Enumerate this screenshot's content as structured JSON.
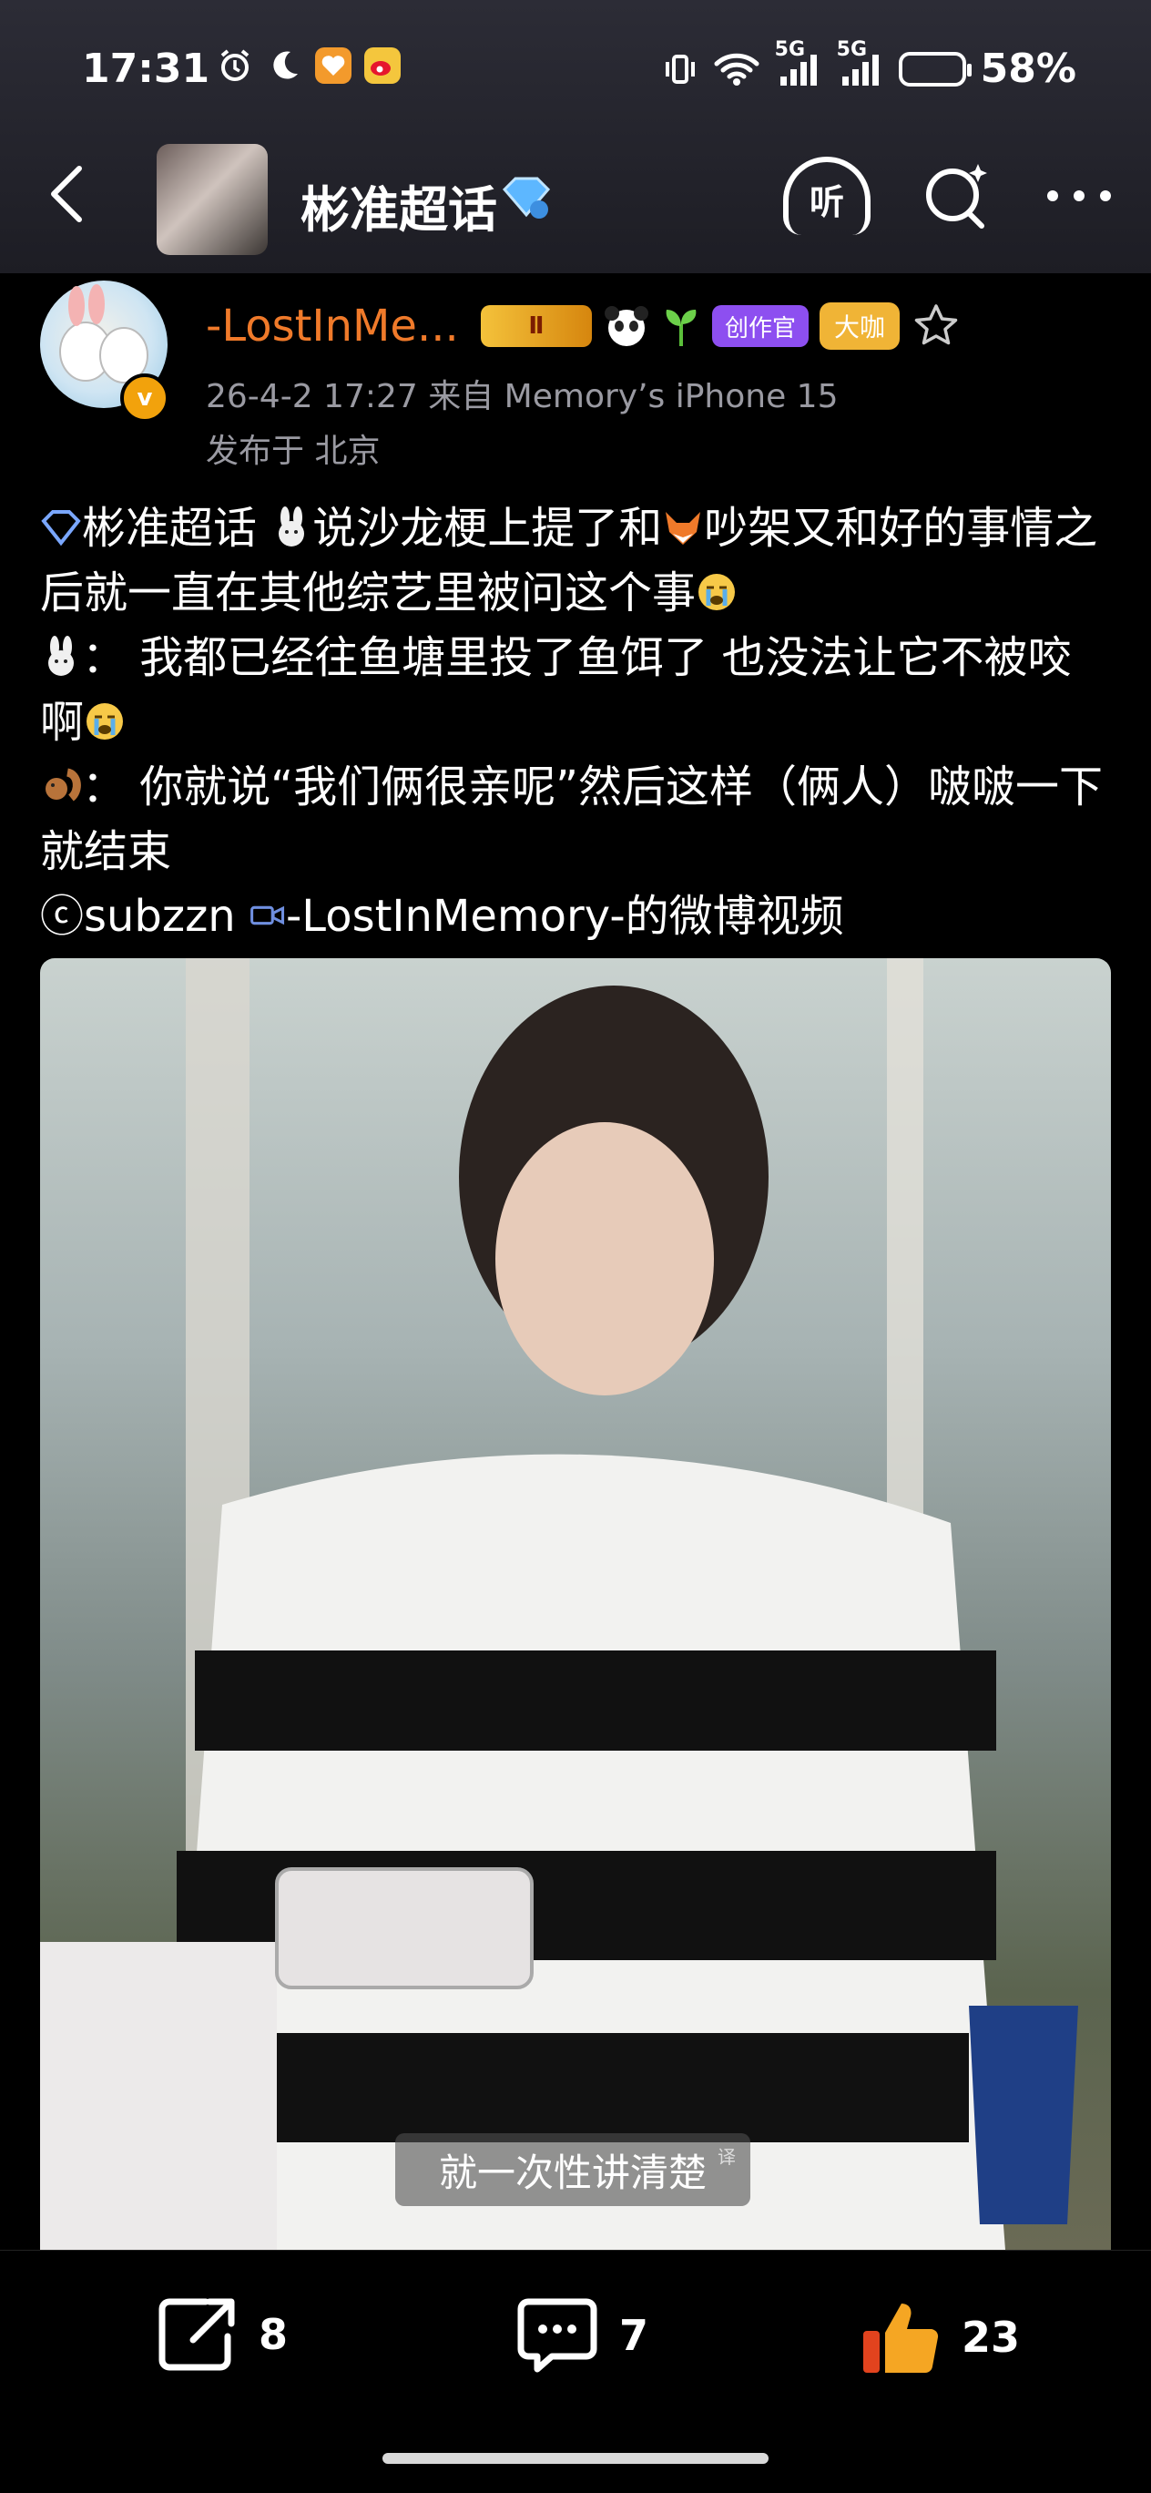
{
  "status_bar": {
    "time": "17:31",
    "signal_labels": [
      "5G",
      "5G"
    ],
    "battery": "58%",
    "left_icons": [
      "alarm-icon",
      "moon-icon",
      "heart-app-icon",
      "weibo-icon"
    ],
    "right_icons": [
      "vibrate-icon",
      "wifi-icon",
      "signal-icon",
      "signal-icon",
      "battery-icon"
    ]
  },
  "nav": {
    "title": "彬准超话",
    "listen_label": "听"
  },
  "post": {
    "author": "-LostInMe...",
    "level_badge": "Ⅱ",
    "creator_badge": "创作官",
    "big_badge": "大咖",
    "meta_time_source": "26-4-2 17:27   来自 Memory’s iPhone 15",
    "meta_location": "发布于 北京",
    "lines": {
      "l1_topic": "彬准超话",
      "l1_text1": "说沙龙梗上提了和",
      "l1_text2": "吵架又和好的事情之后就一直在其他综艺里被问这个事",
      "l2_text": "：  我都已经往鱼塘里投了鱼饵了 也没法让它不被咬啊",
      "l3_text": "：  你就说“我们俩很亲呢”然后这样（俩人）啵啵一下就结束",
      "l4_copyright": "ⓒsubzzn",
      "l4_video_link": "-LostInMemory-的微博视频"
    },
    "video_subtitle": "就一次性讲清楚",
    "video_subtitle_tag": "译"
  },
  "actions": {
    "share_count": "8",
    "comment_count": "7",
    "like_count": "23"
  },
  "colors": {
    "author": "#f07a2a",
    "like": "#f5a623",
    "meta": "#9a9aa2"
  }
}
